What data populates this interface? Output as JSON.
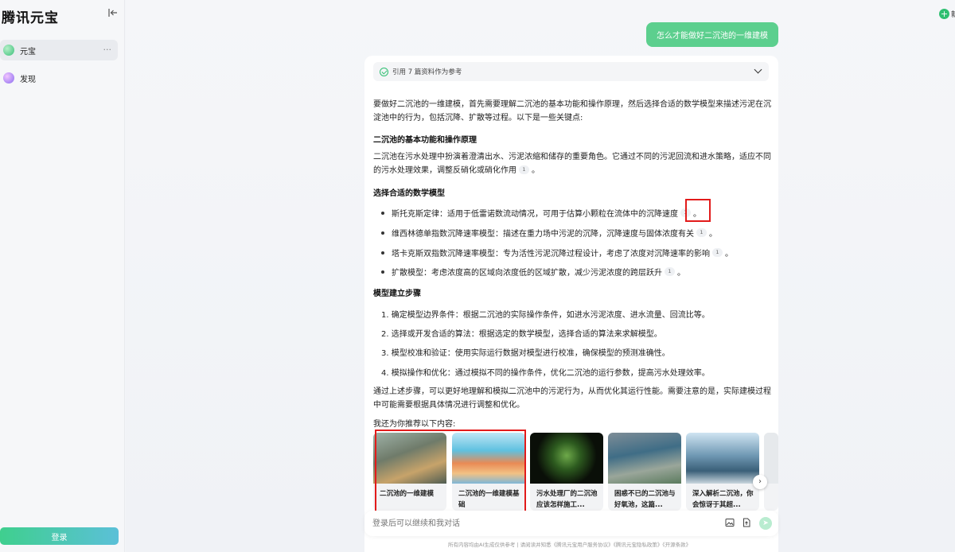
{
  "sidebar": {
    "logo": "腾讯元宝",
    "items": [
      {
        "label": "元宝",
        "more": "···"
      },
      {
        "label": "发现"
      }
    ],
    "login_label": "登录"
  },
  "header": {
    "new_chat_label": "新"
  },
  "conversation": {
    "user_message": "怎么才能做好二沉池的一维建模",
    "reference_summary": "引用 7 篇资料作为参考",
    "intro": "要做好二沉池的一维建模，首先需要理解二沉池的基本功能和操作原理，然后选择合适的数学模型来描述污泥在沉淀池中的行为，包括沉降、扩散等过程。以下是一些关键点:",
    "section1_title": "二沉池的基本功能和操作原理",
    "section1_body": "二沉池在污水处理中扮演着澄清出水、污泥浓缩和储存的重要角色。它通过不同的污泥回流和进水策略，适应不同的污水处理效果，调整反硝化或硝化作用",
    "section2_title": "选择合适的数学模型",
    "models": [
      "斯托克斯定律：适用于低雷诺数流动情况，可用于估算小颗粒在流体中的沉降速度",
      "维西林德单指数沉降速率模型：描述在重力场中污泥的沉降，沉降速度与固体浓度有关",
      "塔卡克斯双指数沉降速率模型：专为活性污泥沉降过程设计，考虑了浓度对沉降速率的影响",
      "扩散模型：考虑浓度高的区域向浓度低的区域扩散，减少污泥浓度的跨层跃升"
    ],
    "section3_title": "模型建立步骤",
    "steps": [
      "1. 确定模型边界条件：根据二沉池的实际操作条件，如进水污泥浓度、进水流量、回流比等。",
      "2. 选择或开发合适的算法：根据选定的数学模型，选择合适的算法来求解模型。",
      "3. 模型校准和验证：使用实际运行数据对模型进行校准，确保模型的预测准确性。",
      "4. 模拟操作和优化：通过模拟不同的操作条件，优化二沉池的运行参数，提高污水处理效率。"
    ],
    "conclusion": "通过上述步骤，可以更好地理解和模拟二沉池中的污泥行为，从而优化其运行性能。需要注意的是，实际建模过程中可能需要根据具体情况进行调整和优化。",
    "cite_mark": "1",
    "period": "。",
    "recommend_label": "我还为你推荐以下内容:",
    "recommendations": [
      {
        "title": "二沉池的一维建模"
      },
      {
        "title": "二沉池的一维建模基础"
      },
      {
        "title": "污水处理厂的二沉池应该怎样施工..."
      },
      {
        "title": "困惑不已的二沉池与好氧池，这篇..."
      },
      {
        "title": "深入解析二沉池，你会惊讶于其超..."
      }
    ]
  },
  "input": {
    "placeholder": "登录后可以继续和我对话"
  },
  "footer": {
    "text": "所有内容均由AI生成仅供参考 | 请阅读并知悉《腾讯元宝用户服务协议》《腾讯元宝隐私政策》《开源条款》"
  },
  "colors": {
    "accent": "#5ccf8e",
    "highlight_box": "#e21b1b"
  },
  "icons": [
    "collapse-sidebar-icon",
    "yuanbao-icon",
    "discover-icon",
    "check-circle-icon",
    "chevron-down-icon",
    "chevron-right-icon",
    "image-upload-icon",
    "file-upload-icon",
    "send-icon",
    "plus-icon"
  ]
}
